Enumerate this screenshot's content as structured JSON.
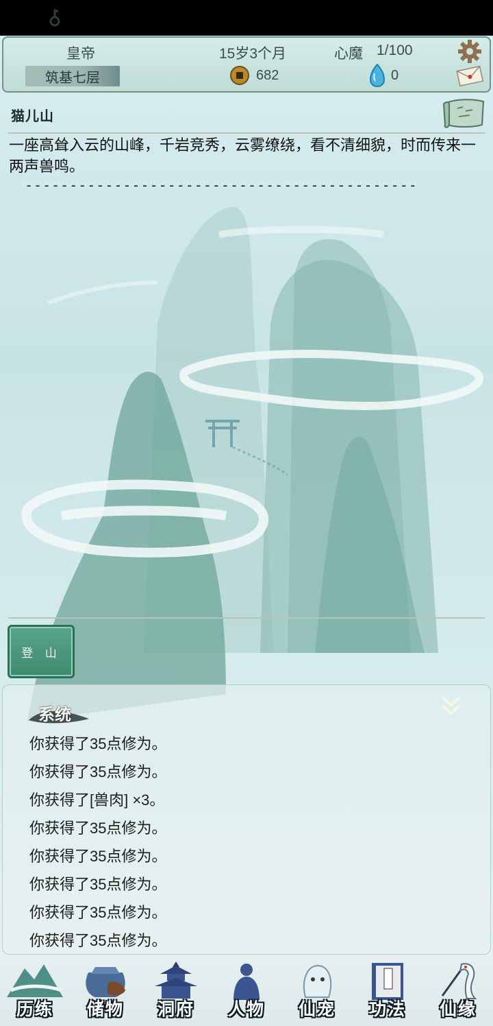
{
  "header": {
    "title": "皇帝",
    "realm": "筑基七层",
    "age": "15岁3个月",
    "demon_label": "心魔",
    "demon_value": "1/100",
    "coins": "682",
    "gems": "0"
  },
  "location": {
    "name": "猫儿山",
    "description": "一座高耸入云的山峰，千岩竞秀，云雾缭绕，看不清细貌，时而传来一两声兽鸣。",
    "separator": "--------------------------------------------"
  },
  "actions": {
    "climb": "登 山"
  },
  "log": {
    "title": "系统",
    "lines": [
      "你获得了35点修为。",
      "你获得了35点修为。",
      "你获得了[兽肉] ×3。",
      "你获得了35点修为。",
      "你获得了35点修为。",
      "你获得了35点修为。",
      "你获得了35点修为。",
      "你获得了35点修为。"
    ]
  },
  "nav": [
    {
      "label": "历练",
      "icon": "mountain-icon"
    },
    {
      "label": "储物",
      "icon": "bag-icon"
    },
    {
      "label": "洞府",
      "icon": "pagoda-icon"
    },
    {
      "label": "人物",
      "icon": "person-icon"
    },
    {
      "label": "仙宠",
      "icon": "pet-icon"
    },
    {
      "label": "功法",
      "icon": "book-icon"
    },
    {
      "label": "仙缘",
      "icon": "crane-icon"
    }
  ],
  "colors": {
    "accent_green": "#4a9a7c",
    "header_bg": "#c6e2dc",
    "panel_border": "#6c9488"
  }
}
